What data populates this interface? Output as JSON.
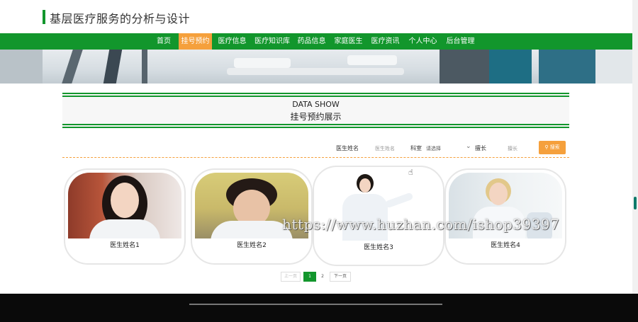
{
  "header": {
    "title": "基层医疗服务的分析与设计"
  },
  "nav": {
    "items": [
      {
        "label": "首页"
      },
      {
        "label": "挂号预约"
      },
      {
        "label": "医疗信息"
      },
      {
        "label": "医疗知识库"
      },
      {
        "label": "药品信息"
      },
      {
        "label": "家庭医生"
      },
      {
        "label": "医疗资讯"
      },
      {
        "label": "个人中心"
      },
      {
        "label": "后台管理"
      }
    ],
    "active_index": 1
  },
  "section": {
    "title_en": "DATA SHOW",
    "title_cn": "挂号预约展示"
  },
  "search": {
    "doctor_name_label": "医生姓名",
    "doctor_name_placeholder": "医生姓名",
    "department_label": "科室",
    "department_value": "请选择",
    "specialty_label": "擅长",
    "specialty_placeholder": "擅长",
    "button_label": "搜索"
  },
  "cards": [
    {
      "name": "医生姓名1"
    },
    {
      "name": "医生姓名2"
    },
    {
      "name": "医生姓名3"
    },
    {
      "name": "医生姓名4"
    }
  ],
  "pagination": {
    "prev": "上一页",
    "pages": [
      "1",
      "2"
    ],
    "current": "1",
    "next": "下一页"
  },
  "watermark": "https://www.huzhan.com/ishop39397",
  "colors": {
    "primary": "#12962c",
    "accent": "#f5a03c"
  }
}
